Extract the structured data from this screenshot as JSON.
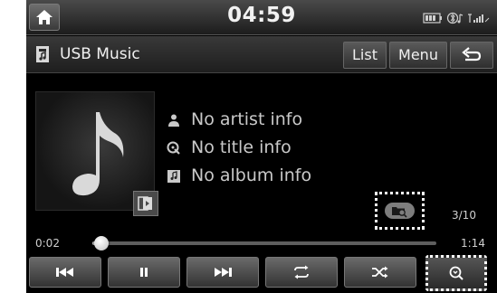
{
  "status_bar": {
    "clock": "04:59"
  },
  "title_bar": {
    "source_title": "USB Music",
    "list_label": "List",
    "menu_label": "Menu"
  },
  "track_info": {
    "artist": "No artist info",
    "title": "No title info",
    "album": "No album info"
  },
  "track_count": "3/10",
  "progress": {
    "elapsed": "0:02",
    "total": "1:14",
    "fraction": 0.027
  },
  "colors": {
    "background": "#000000",
    "button_gradient_top": "#6a6a6a",
    "button_gradient_bottom": "#333333",
    "text": "#c9c9c9"
  },
  "icons": {
    "home": "home-icon",
    "source": "music-file-icon",
    "back": "back-arrow-icon",
    "artist": "person-icon",
    "title": "song-title-icon",
    "album": "album-icon",
    "folder_search": "folder-search-icon",
    "prev": "skip-previous-icon",
    "pause": "pause-icon",
    "next": "skip-next-icon",
    "repeat": "repeat-icon",
    "shuffle": "shuffle-icon",
    "scan": "scan-search-icon"
  }
}
